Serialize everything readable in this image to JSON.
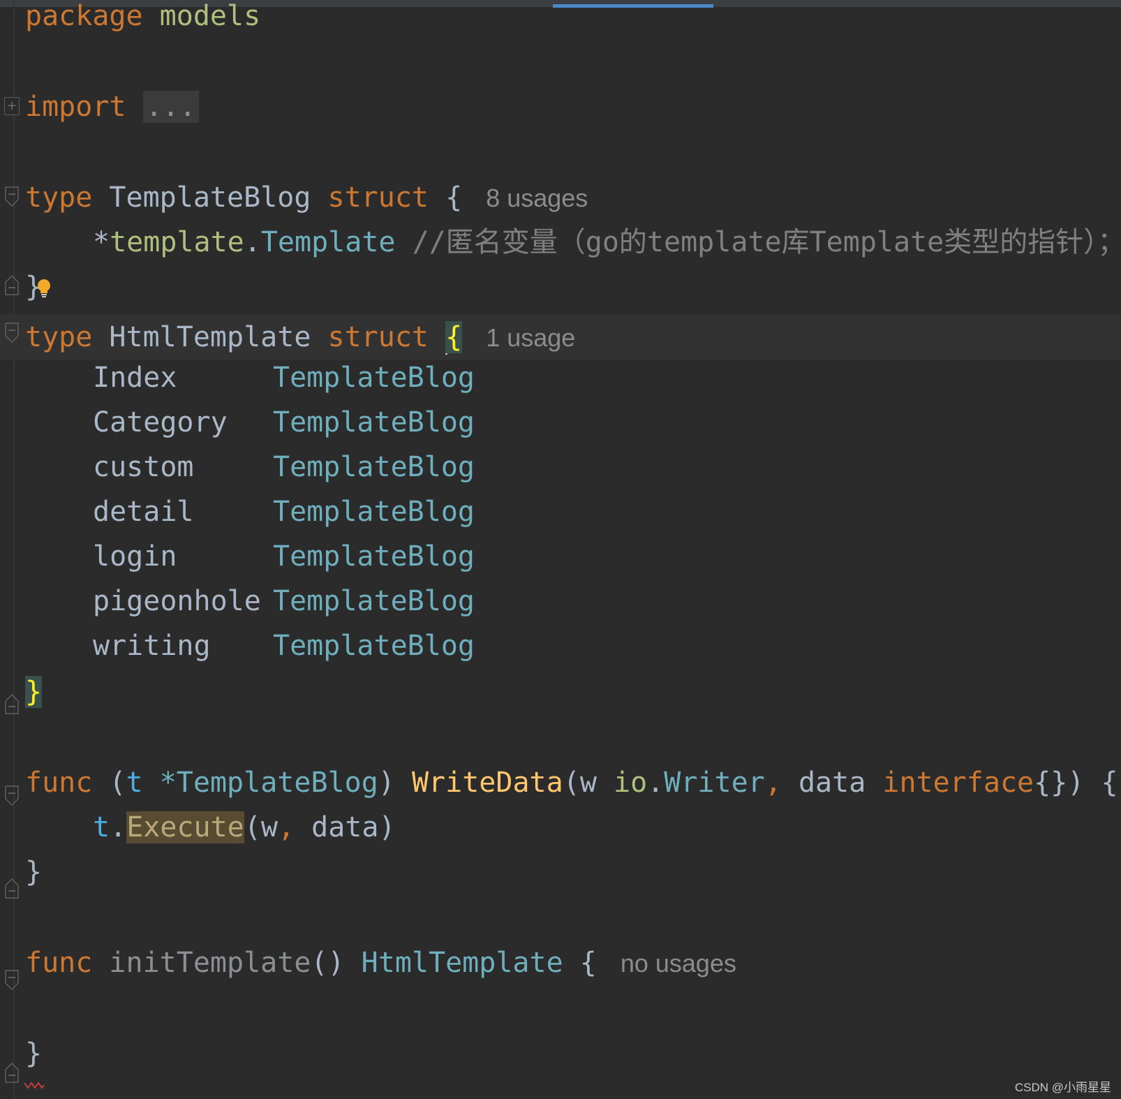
{
  "lines": {
    "package": {
      "keyword": "package",
      "name": "models"
    },
    "import": {
      "keyword": "import",
      "folded": "..."
    },
    "template_blog": {
      "kw_type": "type",
      "name": "TemplateBlog",
      "kw_struct": "struct",
      "open": "{",
      "hint": "8 usages"
    },
    "template_field": {
      "star": "*",
      "pkg": "template",
      "dot": ".",
      "type": "Template",
      "comment": "//匿名变量（go的template库Template类型的指针）；"
    },
    "template_blog_close": {
      "close": "}"
    },
    "html_template": {
      "kw_type": "type",
      "name": "HtmlTemplate",
      "kw_struct": "struct",
      "open": "{",
      "hint": "1 usage"
    },
    "fields": [
      {
        "name": "Index",
        "type": "TemplateBlog"
      },
      {
        "name": "Category",
        "type": "TemplateBlog"
      },
      {
        "name": "custom",
        "type": "TemplateBlog"
      },
      {
        "name": "detail",
        "type": "TemplateBlog"
      },
      {
        "name": "login",
        "type": "TemplateBlog"
      },
      {
        "name": "pigeonhole",
        "type": "TemplateBlog"
      },
      {
        "name": "writing",
        "type": "TemplateBlog"
      }
    ],
    "html_template_close": {
      "close": "}"
    },
    "write_data": {
      "kw_func": "func",
      "lparen": "(",
      "recv": "t",
      "recv_type": "*TemplateBlog",
      "rparen": ")",
      "fn_name": "WriteData",
      "params_open": "(",
      "p1": "w",
      "p1_pkg": "io",
      "p1_dot": ".",
      "p1_type": "Writer",
      "comma": ",",
      "p2": "data",
      "p2_type": "interface",
      "p2_braces": "{}",
      "params_close": ")",
      "open": "{"
    },
    "execute_call": {
      "recv": "t",
      "dot": ".",
      "method": "Execute",
      "open": "(",
      "arg1": "w",
      "comma": ",",
      "arg2": "data",
      "close": ")"
    },
    "write_data_close": {
      "close": "}"
    },
    "init_template": {
      "kw_func": "func",
      "fn_name": "initTemplate",
      "parens": "()",
      "ret_type": "HtmlTemplate",
      "open": "{",
      "hint": "no usages"
    },
    "init_template_close": {
      "close": "}"
    }
  },
  "watermark": "CSDN @小雨星星",
  "colors": {
    "background": "#2b2b2b",
    "keyword": "#cc7832",
    "type": "#6fafbd",
    "function": "#ffc66d",
    "comment": "#808080",
    "hint": "#8c8c8c",
    "brace_match": "#ffef28",
    "tab_indicator": "#4a88c7"
  }
}
